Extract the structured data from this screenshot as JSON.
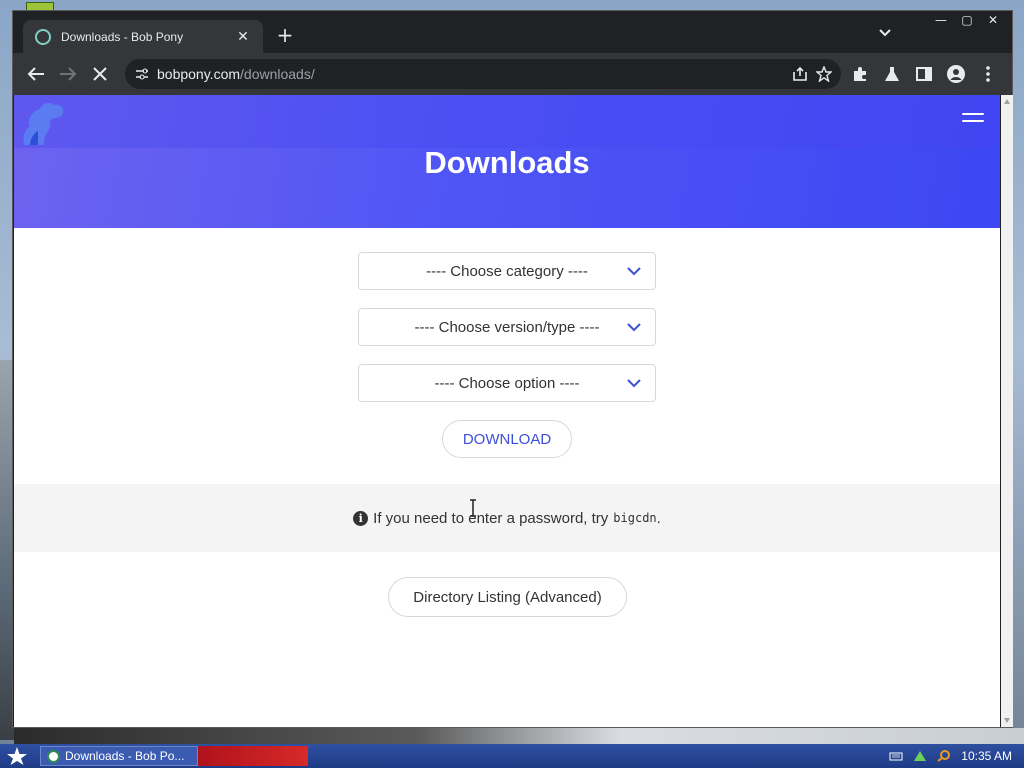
{
  "browser": {
    "tab_title": "Downloads - Bob Pony",
    "new_tab_label": "+",
    "close_tab_label": "✕",
    "url_host": "bobpony.com",
    "url_path": "/downloads/",
    "window_controls": {
      "minimize": "—",
      "maximize": "▢",
      "close": "✕"
    }
  },
  "page": {
    "title": "Downloads",
    "selects": [
      {
        "placeholder": "---- Choose category ----"
      },
      {
        "placeholder": "---- Choose version/type ----"
      },
      {
        "placeholder": "---- Choose option ----"
      }
    ],
    "download_button": "DOWNLOAD",
    "notice": {
      "text": "If you need to enter a password, try",
      "password": "bigcdn",
      "suffix": "."
    },
    "directory_button": "Directory Listing (Advanced)"
  },
  "taskbar": {
    "task_label": "Downloads - Bob Po...",
    "clock": "10:35 AM"
  },
  "colors": {
    "hero_start": "#6d63ef",
    "hero_end": "#3d47f2",
    "accent": "#3d4fd6"
  }
}
